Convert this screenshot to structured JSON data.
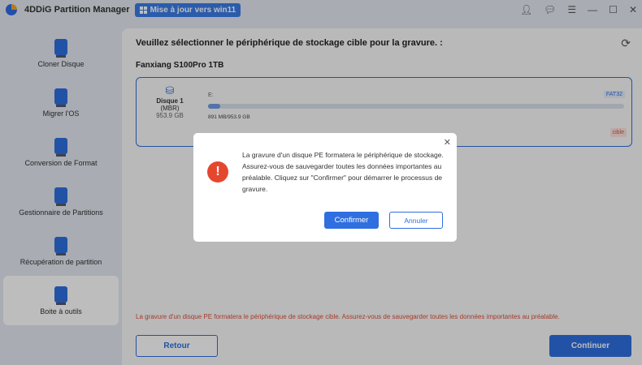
{
  "app": {
    "title": "4DDiG Partition Manager",
    "upgrade_label": "Mise à jour vers win11"
  },
  "sidebar": {
    "items": [
      {
        "label": "Cloner Disque"
      },
      {
        "label": "Migrer l'OS"
      },
      {
        "label": "Conversion de Format"
      },
      {
        "label": "Gestionnaire de Partitions"
      },
      {
        "label": "Récupération de partition"
      },
      {
        "label": "Boite à outils"
      }
    ]
  },
  "main": {
    "heading": "Veuillez sélectionner le périphérique de stockage cible pour la gravure. :",
    "device_name": "Fanxiang S100Pro 1TB",
    "disk": {
      "name": "Disque 1",
      "type": "(MBR)",
      "size": "953.9 GB",
      "partition_letter": "E:",
      "filesystem": "FAT32",
      "usage": "891 MB/953.9 GB",
      "used_fraction": 0.0009,
      "tag": "cible"
    },
    "warning": "La gravure d'un disque PE formatera le périphérique de stockage cible. Assurez-vous de sauvegarder toutes les données importantes au préalable.",
    "back_label": "Retour",
    "continue_label": "Continuer"
  },
  "dialog": {
    "message": "La gravure d'un disque PE formatera le périphérique de stockage. Assurez-vous de sauvegarder toutes les données importantes au préalable. Cliquez sur \"Confirmer\" pour démarrer le processus de gravure.",
    "confirm_label": "Confirmer",
    "cancel_label": "Annuler"
  }
}
